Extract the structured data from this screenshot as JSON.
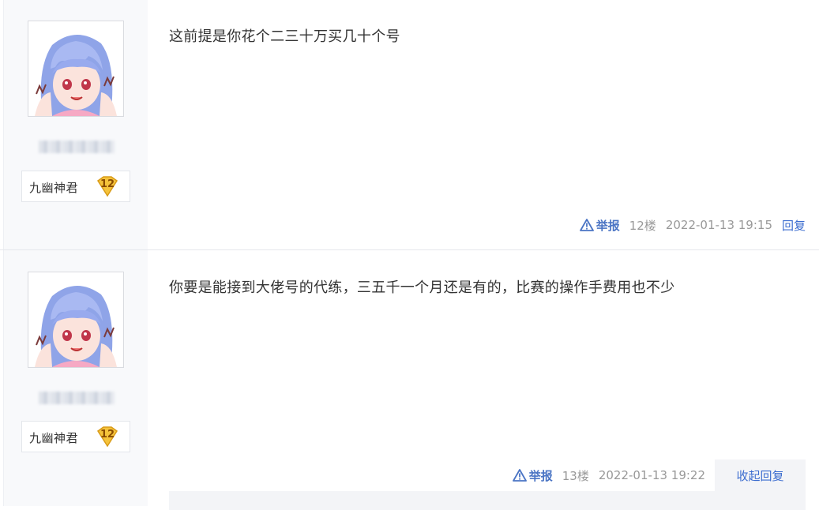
{
  "posts": [
    {
      "user_badge": "九幽神君",
      "level": "12",
      "content": "这前提是你花个二三十万买几十个号",
      "report_label": "举报",
      "floor": "12楼",
      "time": "2022-01-13 19:15",
      "reply_label": "回复"
    },
    {
      "user_badge": "九幽神君",
      "level": "12",
      "content": "你要是能接到大佬号的代练，三五千一个月还是有的，比赛的操作手费用也不少",
      "report_label": "举报",
      "floor": "13楼",
      "time": "2022-01-13 19:22",
      "reply_label": "收起回复"
    }
  ],
  "colors": {
    "link": "#3b6ccf",
    "meta": "#999999",
    "sidebar_bg": "#f8f9fb",
    "badge_gold": "#f5c33b"
  },
  "icons": {
    "report": "warning-triangle-icon",
    "level": "heart-level-badge-icon"
  }
}
